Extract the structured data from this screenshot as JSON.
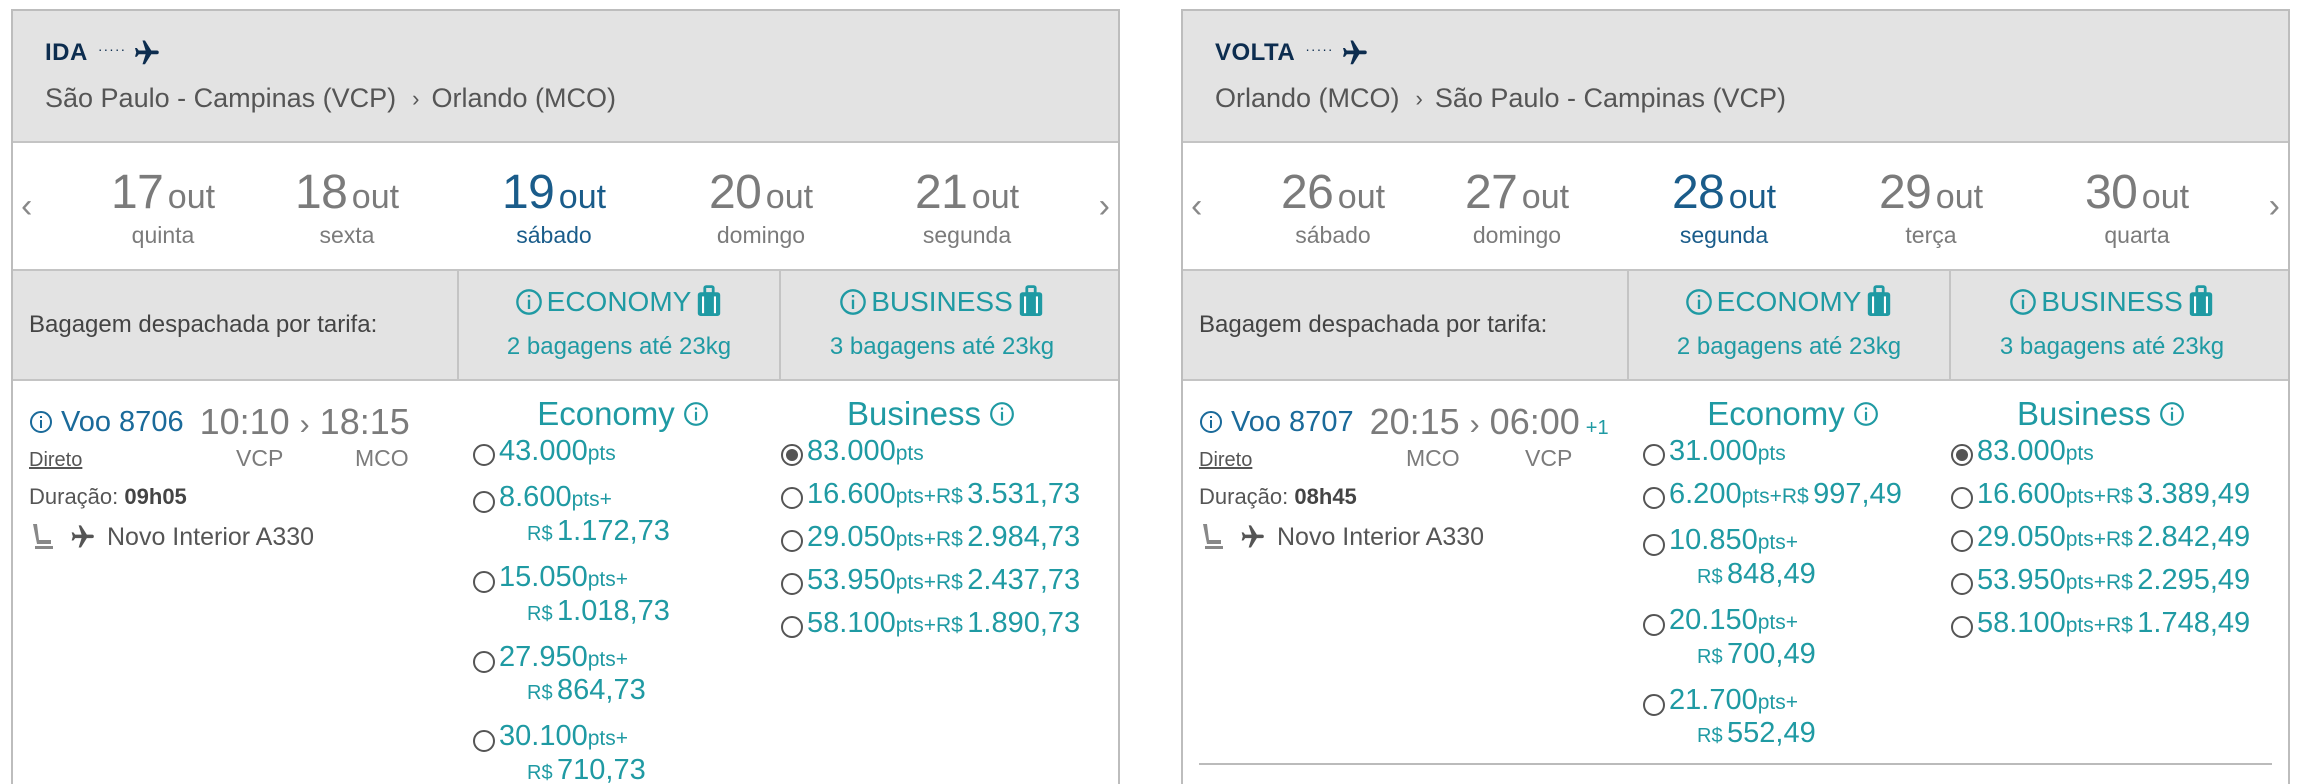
{
  "outbound": {
    "direction": "IDA",
    "origin": "São Paulo - Campinas (VCP)",
    "destination": "Orlando (MCO)",
    "dates": [
      {
        "day": "17",
        "month": "out",
        "weekday": "quinta"
      },
      {
        "day": "18",
        "month": "out",
        "weekday": "sexta"
      },
      {
        "day": "19",
        "month": "out",
        "weekday": "sábado"
      },
      {
        "day": "20",
        "month": "out",
        "weekday": "domingo"
      },
      {
        "day": "21",
        "month": "out",
        "weekday": "segunda"
      }
    ],
    "selected_date_index": 2,
    "baggage": {
      "label": "Bagagem despachada por tarifa:",
      "economy_title": "ECONOMY",
      "economy_sub": "2 bagagens até 23kg",
      "business_title": "BUSINESS",
      "business_sub": "3 bagagens até 23kg"
    },
    "flight": {
      "number": "Voo 8706",
      "depart": "10:10",
      "arrive": "18:15",
      "from": "VCP",
      "to": "MCO",
      "type": "Direto",
      "duration_label": "Duração:",
      "duration": "09h05",
      "aircraft": "Novo Interior A330"
    },
    "economy": {
      "title": "Economy",
      "options": [
        {
          "pts": "43.000",
          "unit": "pts"
        },
        {
          "pts": "8.600",
          "unit": "pts+",
          "currency": "R$",
          "money": "1.172,73"
        },
        {
          "pts": "15.050",
          "unit": "pts+",
          "currency": "R$",
          "money": "1.018,73"
        },
        {
          "pts": "27.950",
          "unit": "pts+",
          "currency": "R$",
          "money": "864,73"
        },
        {
          "pts": "30.100",
          "unit": "pts+",
          "currency": "R$",
          "money": "710,73"
        }
      ]
    },
    "business": {
      "title": "Business",
      "options": [
        {
          "pts": "83.000",
          "unit": "pts"
        },
        {
          "pts": "16.600",
          "unit": "pts+R$",
          "money": "3.531,73"
        },
        {
          "pts": "29.050",
          "unit": "pts+R$",
          "money": "2.984,73"
        },
        {
          "pts": "53.950",
          "unit": "pts+R$",
          "money": "2.437,73"
        },
        {
          "pts": "58.100",
          "unit": "pts+R$",
          "money": "1.890,73"
        }
      ]
    }
  },
  "return": {
    "direction": "VOLTA",
    "origin": "Orlando (MCO)",
    "destination": "São Paulo - Campinas (VCP)",
    "dates": [
      {
        "day": "26",
        "month": "out",
        "weekday": "sábado"
      },
      {
        "day": "27",
        "month": "out",
        "weekday": "domingo"
      },
      {
        "day": "28",
        "month": "out",
        "weekday": "segunda"
      },
      {
        "day": "29",
        "month": "out",
        "weekday": "terça"
      },
      {
        "day": "30",
        "month": "out",
        "weekday": "quarta"
      }
    ],
    "selected_date_index": 2,
    "baggage": {
      "label": "Bagagem despachada por tarifa:",
      "economy_title": "ECONOMY",
      "economy_sub": "2 bagagens até 23kg",
      "business_title": "BUSINESS",
      "business_sub": "3 bagagens até 23kg"
    },
    "flight": {
      "number": "Voo 8707",
      "depart": "20:15",
      "arrive": "06:00",
      "plus_day": "+1",
      "from": "MCO",
      "to": "VCP",
      "type": "Direto",
      "duration_label": "Duração:",
      "duration": "08h45",
      "aircraft": "Novo Interior A330"
    },
    "economy": {
      "title": "Economy",
      "options": [
        {
          "pts": "31.000",
          "unit": "pts"
        },
        {
          "pts": "6.200",
          "unit": "pts+R$",
          "money": "997,49"
        },
        {
          "pts": "10.850",
          "unit": "pts+",
          "currency": "R$",
          "money": "848,49"
        },
        {
          "pts": "20.150",
          "unit": "pts+",
          "currency": "R$",
          "money": "700,49"
        },
        {
          "pts": "21.700",
          "unit": "pts+",
          "currency": "R$",
          "money": "552,49"
        }
      ]
    },
    "business": {
      "title": "Business",
      "options": [
        {
          "pts": "83.000",
          "unit": "pts"
        },
        {
          "pts": "16.600",
          "unit": "pts+R$",
          "money": "3.389,49"
        },
        {
          "pts": "29.050",
          "unit": "pts+R$",
          "money": "2.842,49"
        },
        {
          "pts": "53.950",
          "unit": "pts+R$",
          "money": "2.295,49"
        },
        {
          "pts": "58.100",
          "unit": "pts+R$",
          "money": "1.748,49"
        }
      ]
    }
  },
  "colors": {
    "teal": "#1f9aa3",
    "navy": "#0d2d4f",
    "selected_date": "#1a5c8a",
    "header_bg": "#e3e3e3"
  },
  "icons": [
    "plane-icon",
    "info-icon",
    "luggage-icon",
    "seat-icon",
    "chevron-left-icon",
    "chevron-right-icon"
  ]
}
